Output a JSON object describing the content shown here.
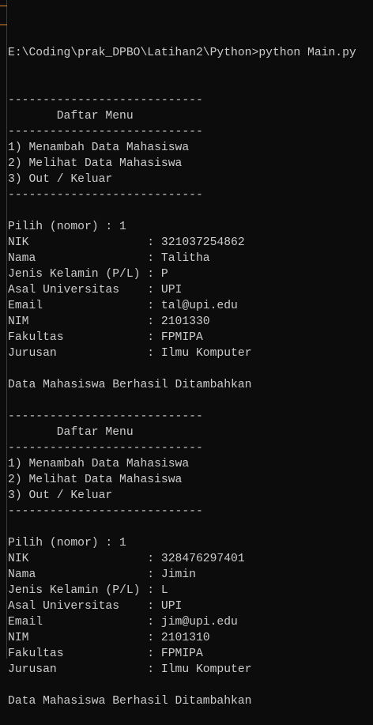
{
  "terminal": {
    "prompt": "E:\\Coding\\prak_DPBO\\Latihan2\\Python>",
    "command": "python Main.py",
    "separator": "----------------------------",
    "menu_title": "Daftar Menu",
    "menu_items": [
      "1) Menambah Data Mahasiswa",
      "2) Melihat Data Mahasiswa",
      "3) Out / Keluar"
    ],
    "choice_prompt": "Pilih (nomor) : ",
    "field_labels": [
      "NIK",
      "Nama",
      "Jenis Kelamin (P/L)",
      "Asal Universitas",
      "Email",
      "NIM",
      "Fakultas",
      "Jurusan"
    ],
    "success_message": "Data Mahasiswa Berhasil Ditambahkan",
    "sessions": [
      {
        "choice": "1",
        "values": [
          "321037254862",
          "Talitha",
          "P",
          "UPI",
          "tal@upi.edu",
          "2101330",
          "FPMIPA",
          "Ilmu Komputer"
        ]
      },
      {
        "choice": "1",
        "values": [
          "328476297401",
          "Jimin",
          "L",
          "UPI",
          "jim@upi.edu",
          "2101310",
          "FPMIPA",
          "Ilmu Komputer"
        ]
      }
    ]
  },
  "colors": {
    "background": "#0c0c0c",
    "text": "#cccccc",
    "marker": "#e0892b"
  }
}
